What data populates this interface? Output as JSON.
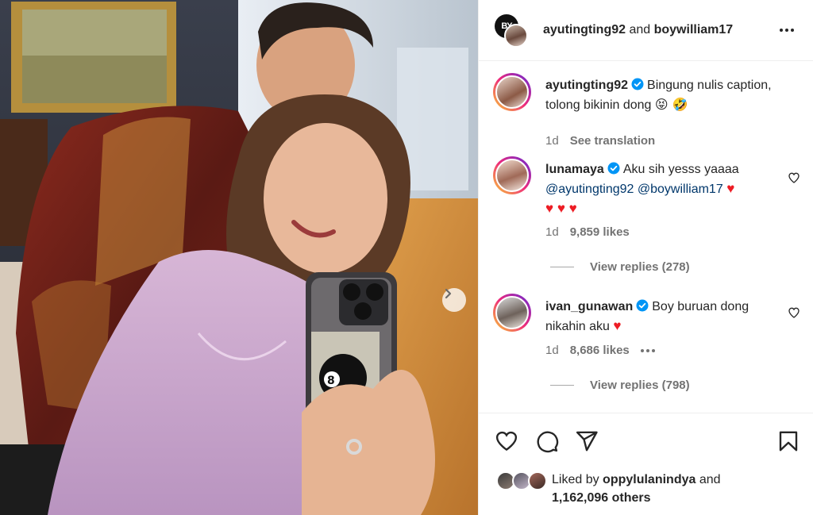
{
  "header": {
    "avatar_initials": "BY",
    "user1": "ayutingting92",
    "joiner": " and ",
    "user2": "boywilliam17"
  },
  "comments": [
    {
      "username": "ayutingting92",
      "verified": true,
      "text": "Bingung nulis caption, tolong bikinin dong",
      "emoji": "😝 🤣",
      "time": "1d",
      "action": "See translation"
    },
    {
      "username": "lunamaya",
      "verified": true,
      "text": "Aku sih yesss yaaaa",
      "mention1": "@ayutingting92",
      "mention2": "@boywilliam17",
      "hearts1": "♥",
      "hearts2": "♥ ♥ ♥",
      "time": "1d",
      "likes": "9,859 likes",
      "replies": "View replies (278)"
    },
    {
      "username": "ivan_gunawan",
      "verified": true,
      "text": "Boy buruan dong nikahin aku",
      "hearts": "♥",
      "time": "1d",
      "likes": "8,686 likes",
      "replies": "View replies (798)"
    }
  ],
  "likes": {
    "prefix": "Liked by",
    "user": "oppylulanindya",
    "suffix": "and",
    "others": "1,162,096 others"
  },
  "colors": {
    "verified_blue": "#0095f6",
    "heart_red": "#ed1c24",
    "mention_blue": "#00376b",
    "meta_gray": "#737373"
  },
  "icons": [
    "more-icon",
    "verified-icon",
    "heart-icon",
    "comment-icon",
    "share-icon",
    "bookmark-icon",
    "chevron-right-icon"
  ]
}
